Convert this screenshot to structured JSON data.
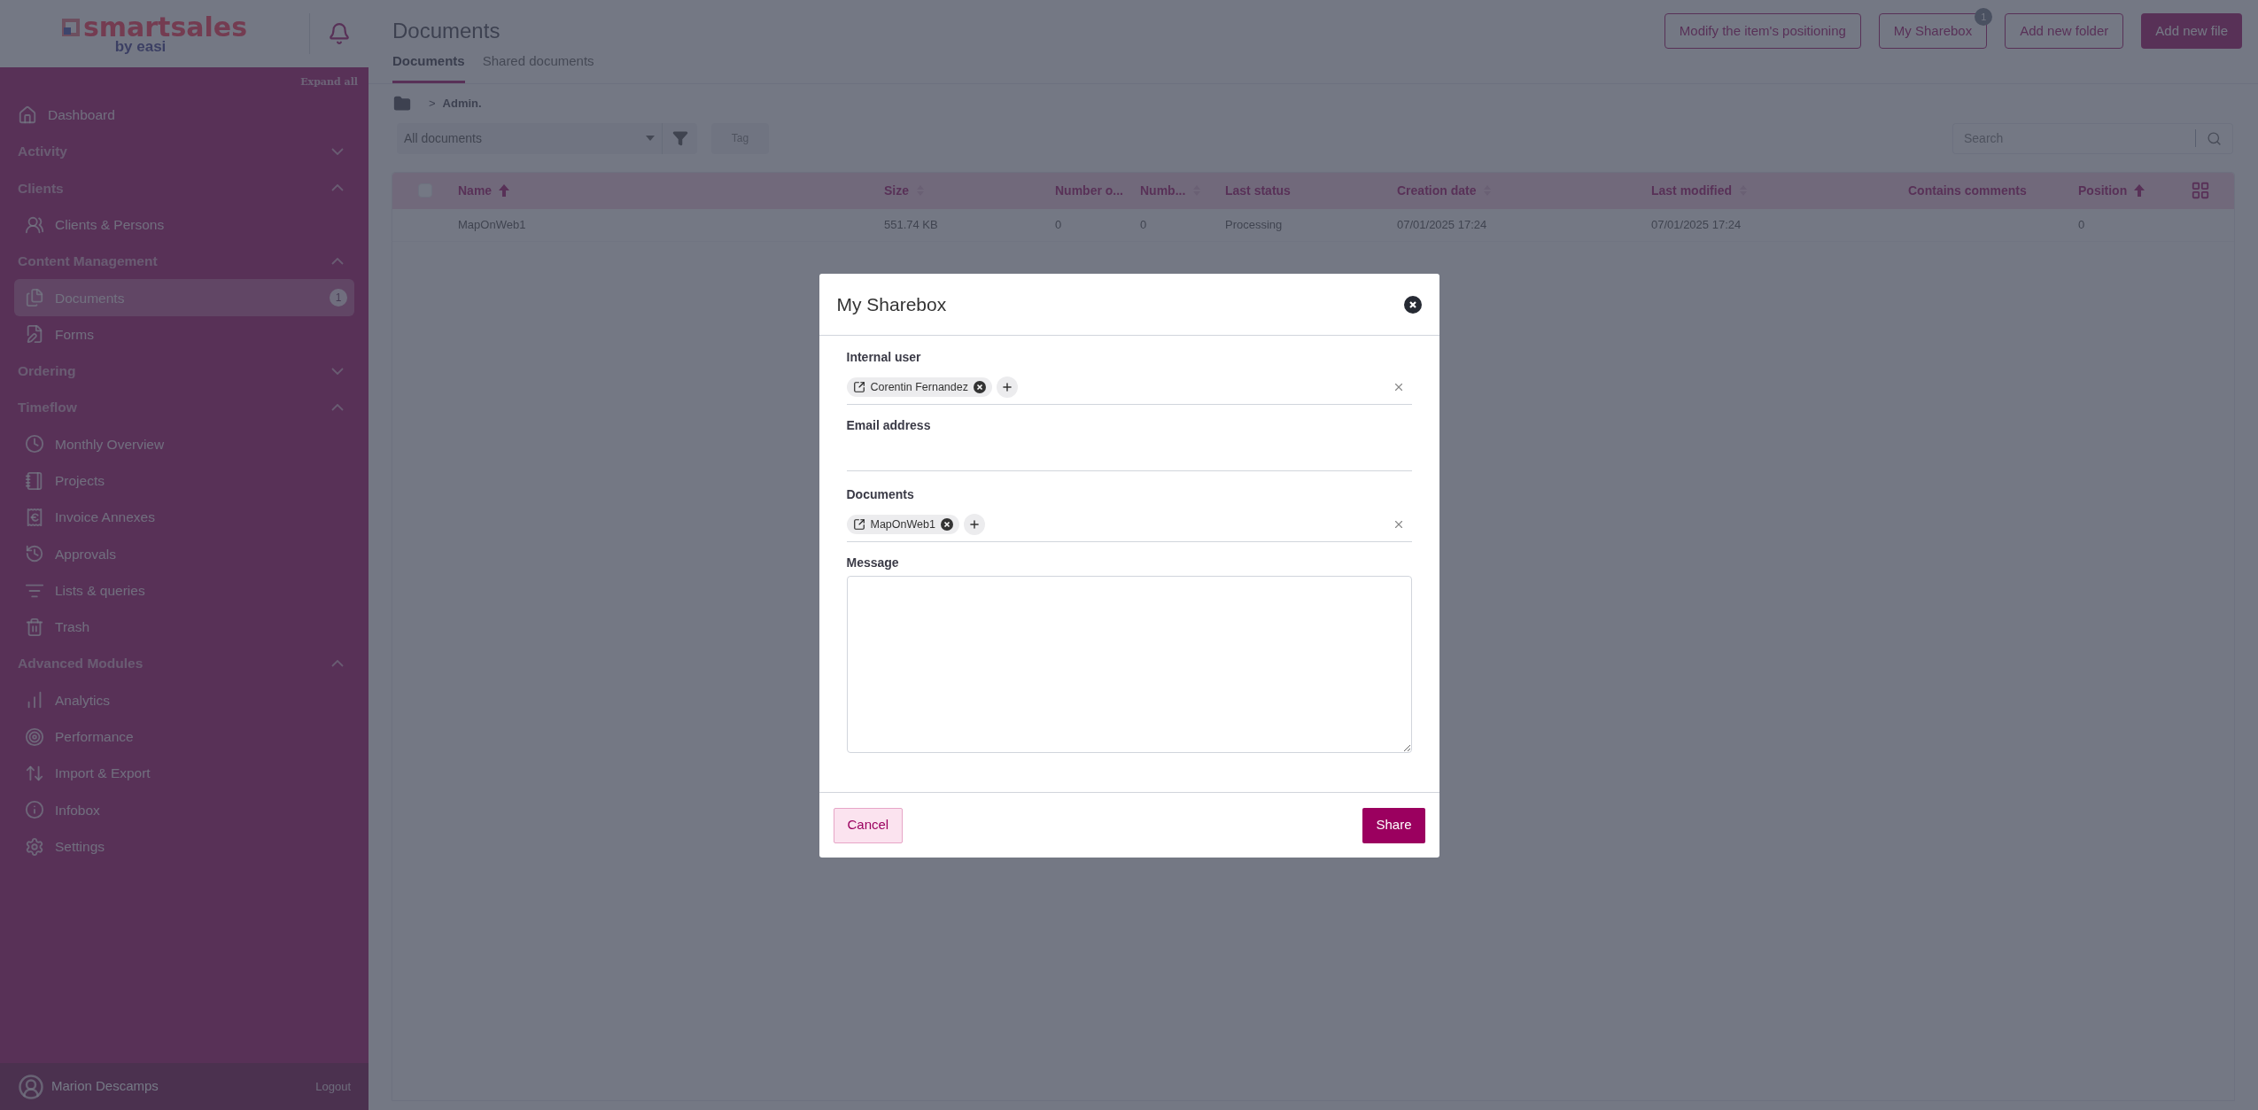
{
  "sidebar": {
    "logo": {
      "wordmark": "smartsales",
      "byline": "by easi"
    },
    "expand_all": "Expand all",
    "items": [
      {
        "kind": "link",
        "label": "Dashboard",
        "selected": false
      },
      {
        "kind": "section",
        "label": "Activity",
        "expanded": false
      },
      {
        "kind": "section",
        "label": "Clients",
        "expanded": true
      },
      {
        "kind": "link",
        "label": "Clients & Persons",
        "selected": false
      },
      {
        "kind": "section",
        "label": "Content Management",
        "expanded": true
      },
      {
        "kind": "link",
        "label": "Documents",
        "selected": true,
        "badge": "1"
      },
      {
        "kind": "link",
        "label": "Forms",
        "selected": false
      },
      {
        "kind": "section",
        "label": "Ordering",
        "expanded": false
      },
      {
        "kind": "section",
        "label": "Timeflow",
        "expanded": true
      },
      {
        "kind": "link",
        "label": "Monthly Overview",
        "selected": false
      },
      {
        "kind": "link",
        "label": "Projects",
        "selected": false
      },
      {
        "kind": "link",
        "label": "Invoice Annexes",
        "selected": false
      },
      {
        "kind": "link",
        "label": "Approvals",
        "selected": false
      },
      {
        "kind": "link",
        "label": "Lists & queries",
        "selected": false
      },
      {
        "kind": "link",
        "label": "Trash",
        "selected": false
      },
      {
        "kind": "section",
        "label": "Advanced Modules",
        "expanded": true
      },
      {
        "kind": "link",
        "label": "Analytics",
        "selected": false
      },
      {
        "kind": "link",
        "label": "Performance",
        "selected": false
      },
      {
        "kind": "link",
        "label": "Import & Export",
        "selected": false
      },
      {
        "kind": "link",
        "label": "Infobox",
        "selected": false
      },
      {
        "kind": "link",
        "label": "Settings",
        "selected": false
      }
    ],
    "user": {
      "name": "Marion Descamps",
      "logout": "Logout"
    }
  },
  "header": {
    "title": "Documents",
    "tabs": [
      {
        "label": "Documents",
        "selected": true
      },
      {
        "label": "Shared documents",
        "selected": false
      }
    ],
    "buttons": [
      {
        "label": "Modify the item's positioning",
        "kind": "outline"
      },
      {
        "label": "My Sharebox",
        "kind": "outline",
        "badge": "1"
      },
      {
        "label": "Add new folder",
        "kind": "outline"
      },
      {
        "label": "Add new file",
        "kind": "primary"
      }
    ]
  },
  "breadcrumb": {
    "separator": ">",
    "path": "Admin."
  },
  "filters": {
    "select": "All documents",
    "tag": "Tag",
    "search": {
      "placeholder": "Search"
    }
  },
  "table": {
    "select_all": {
      "checked": false
    },
    "columns": [
      {
        "label": "Name",
        "sorted": true
      },
      {
        "label": "Size",
        "sorted": false
      },
      {
        "label": "Number o..."
      },
      {
        "label": "Numb...",
        "sorted": false
      },
      {
        "label": "Last status"
      },
      {
        "label": "Creation date",
        "sorted": false
      },
      {
        "label": "Last modified",
        "sorted": false
      },
      {
        "label": "Contains comments"
      },
      {
        "label": "Position",
        "sorted": true
      }
    ],
    "rows": [
      {
        "cells": [
          "MapOnWeb1",
          "551.74 KB",
          "0",
          "0",
          "Processing",
          "07/01/2025 17:24",
          "07/01/2025 17:24",
          null,
          "0"
        ]
      }
    ]
  },
  "dialog": {
    "title": "My Sharebox",
    "fields": [
      {
        "kind": "chips",
        "label": "Internal user",
        "chips": [
          "Corentin Fernandez"
        ]
      },
      {
        "kind": "text",
        "label": "Email address"
      },
      {
        "kind": "chips",
        "label": "Documents",
        "chips": [
          "MapOnWeb1"
        ]
      },
      {
        "kind": "textarea",
        "label": "Message"
      }
    ],
    "buttons": [
      {
        "label": "Cancel",
        "kind": "secondary"
      },
      {
        "label": "Share",
        "kind": "primary"
      }
    ]
  }
}
